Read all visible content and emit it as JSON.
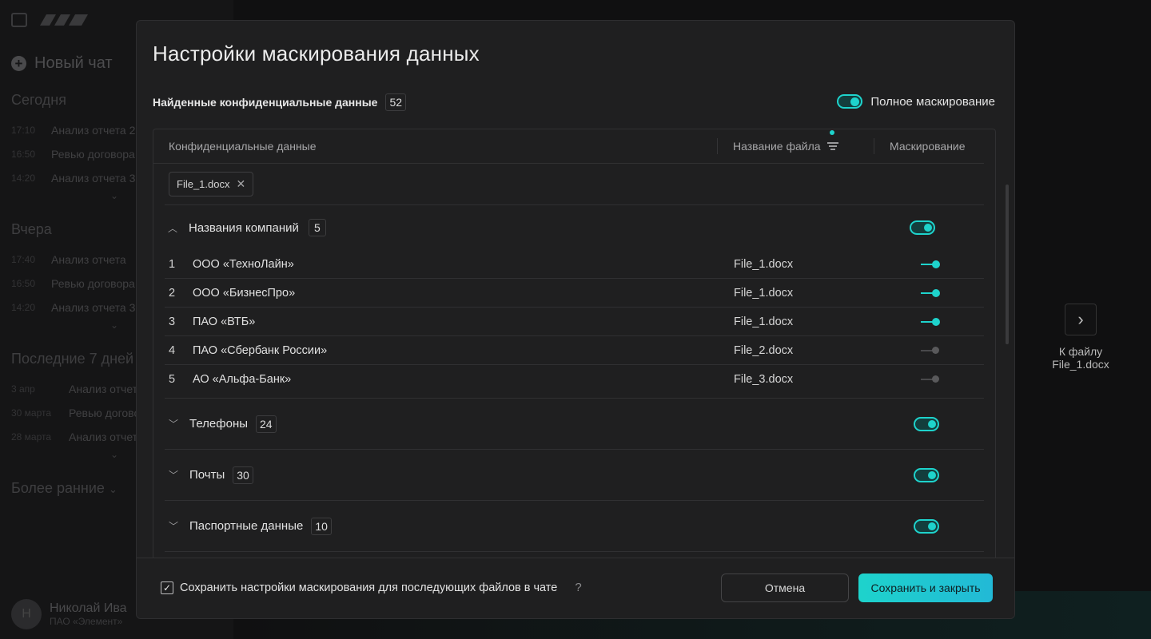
{
  "sidebar": {
    "new_chat": "Новый чат",
    "sections": [
      {
        "title": "Сегодня",
        "items": [
          {
            "time": "17:10",
            "label": "Анализ отчета 2"
          },
          {
            "time": "16:50",
            "label": "Ревью договора"
          },
          {
            "time": "14:20",
            "label": "Анализ отчета 3"
          }
        ]
      },
      {
        "title": "Вчера",
        "items": [
          {
            "time": "17:40",
            "label": "Анализ отчета"
          },
          {
            "time": "16:50",
            "label": "Ревью договора"
          },
          {
            "time": "14:20",
            "label": "Анализ отчета 3"
          }
        ]
      },
      {
        "title": "Последние 7 дней",
        "items": [
          {
            "time": "3 апр",
            "label": "Анализ отчета"
          },
          {
            "time": "30 марта",
            "label": "Ревью договора"
          },
          {
            "time": "28 марта",
            "label": "Анализ отчета"
          }
        ]
      }
    ],
    "earlier": "Более ранние",
    "user": {
      "initial": "Н",
      "name": "Николай Ива",
      "org": "ПАО «Элемент»"
    }
  },
  "next_file": {
    "label_line1": "К файлу",
    "label_line2": "File_1.docx"
  },
  "modal": {
    "title": "Настройки маскирования данных",
    "found_label": "Найденные конфиденциальные данные",
    "found_count": "52",
    "full_mask_label": "Полное маскирование",
    "full_mask_on": true,
    "columns": {
      "data": "Конфиденциальные данные",
      "file": "Название файла",
      "mask": "Маскирование"
    },
    "filter_chip": "File_1.docx",
    "groups": [
      {
        "label": "Названия компаний",
        "count": "5",
        "expanded": true,
        "masked": true,
        "rows": [
          {
            "n": "1",
            "name": "ООО «ТехноЛайн»",
            "file": "File_1.docx",
            "masked": true
          },
          {
            "n": "2",
            "name": "ООО «БизнесПро»",
            "file": "File_1.docx",
            "masked": true
          },
          {
            "n": "3",
            "name": "ПАО «ВТБ»",
            "file": "File_1.docx",
            "masked": true
          },
          {
            "n": "4",
            "name": "ПАО «Сбербанк России»",
            "file": "File_2.docx",
            "masked": false
          },
          {
            "n": "5",
            "name": "АО «Альфа-Банк»",
            "file": "File_3.docx",
            "masked": false
          }
        ]
      },
      {
        "label": "Телефоны",
        "count": "24",
        "expanded": false,
        "masked": true
      },
      {
        "label": "Почты",
        "count": "30",
        "expanded": false,
        "masked": true
      },
      {
        "label": "Паспортные данные",
        "count": "10",
        "expanded": false,
        "masked": true
      }
    ],
    "footer": {
      "save_settings_label": "Сохранить настройки маскирования для последующих файлов в чате",
      "save_settings_checked": true,
      "help": "?",
      "cancel": "Отмена",
      "save_close": "Сохранить и закрыть"
    }
  },
  "colors": {
    "accent": "#1ed3cc",
    "modal_bg": "#1f1f20",
    "backdrop": "#0e0e0f"
  }
}
